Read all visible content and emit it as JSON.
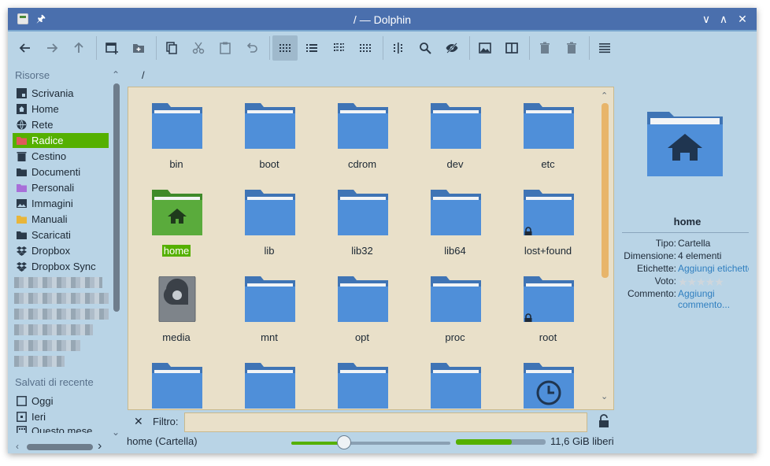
{
  "window": {
    "title": "/ — Dolphin",
    "controls": [
      "minimize",
      "maximize",
      "close"
    ]
  },
  "toolbar": {
    "buttons": [
      {
        "name": "back",
        "icon": "arrow-left-icon"
      },
      {
        "name": "forward",
        "icon": "arrow-right-icon"
      },
      {
        "name": "up",
        "icon": "arrow-up-icon"
      },
      {
        "name": "new-window",
        "icon": "new-window-icon"
      },
      {
        "name": "new-folder",
        "icon": "new-folder-icon"
      },
      {
        "name": "copy",
        "icon": "copy-icon"
      },
      {
        "name": "cut",
        "icon": "scissors-icon"
      },
      {
        "name": "paste",
        "icon": "paste-icon"
      },
      {
        "name": "undo",
        "icon": "undo-icon"
      },
      {
        "name": "icons-view",
        "icon": "icons-view-icon",
        "active": true
      },
      {
        "name": "details-view",
        "icon": "details-view-icon"
      },
      {
        "name": "compact-view",
        "icon": "compact-view-icon"
      },
      {
        "name": "preview-view",
        "icon": "grid-small-icon"
      },
      {
        "name": "columns",
        "icon": "columns-dots-icon"
      },
      {
        "name": "search",
        "icon": "search-icon"
      },
      {
        "name": "hidden-files",
        "icon": "eye-hidden-icon"
      },
      {
        "name": "previews",
        "icon": "image-icon"
      },
      {
        "name": "split",
        "icon": "split-view-icon"
      },
      {
        "name": "trash",
        "icon": "trash-icon"
      },
      {
        "name": "delete",
        "icon": "delete-icon"
      },
      {
        "name": "menu",
        "icon": "hamburger-menu-icon"
      }
    ]
  },
  "sidebar": {
    "places_header": "Risorse",
    "places": [
      {
        "label": "Scrivania",
        "icon": "desktop-icon"
      },
      {
        "label": "Home",
        "icon": "home-icon"
      },
      {
        "label": "Rete",
        "icon": "network-icon"
      },
      {
        "label": "Radice",
        "icon": "root-folder-icon",
        "selected": true
      },
      {
        "label": "Cestino",
        "icon": "trash-icon"
      },
      {
        "label": "Documenti",
        "icon": "documents-folder-icon"
      },
      {
        "label": "Personali",
        "icon": "personal-folder-icon"
      },
      {
        "label": "Immagini",
        "icon": "pictures-folder-icon"
      },
      {
        "label": "Manuali",
        "icon": "manuals-folder-icon"
      },
      {
        "label": "Scaricati",
        "icon": "downloads-folder-icon"
      },
      {
        "label": "Dropbox",
        "icon": "dropbox-icon"
      },
      {
        "label": "Dropbox Sync",
        "icon": "dropbox-icon"
      }
    ],
    "recent_header": "Salvati di recente",
    "recent": [
      {
        "label": "Oggi",
        "icon": "calendar-today-icon"
      },
      {
        "label": "Ieri",
        "icon": "calendar-yesterday-icon"
      },
      {
        "label": "Questo mese",
        "icon": "calendar-month-icon"
      }
    ]
  },
  "breadcrumb": "/",
  "files": [
    {
      "label": "bin",
      "type": "folder"
    },
    {
      "label": "boot",
      "type": "folder"
    },
    {
      "label": "cdrom",
      "type": "folder"
    },
    {
      "label": "dev",
      "type": "folder"
    },
    {
      "label": "etc",
      "type": "folder"
    },
    {
      "label": "home",
      "type": "home",
      "selected": true
    },
    {
      "label": "lib",
      "type": "folder"
    },
    {
      "label": "lib32",
      "type": "folder"
    },
    {
      "label": "lib64",
      "type": "folder"
    },
    {
      "label": "lost+found",
      "type": "locked"
    },
    {
      "label": "media",
      "type": "media"
    },
    {
      "label": "mnt",
      "type": "folder"
    },
    {
      "label": "opt",
      "type": "folder"
    },
    {
      "label": "proc",
      "type": "folder"
    },
    {
      "label": "root",
      "type": "locked"
    },
    {
      "label": "",
      "type": "folder"
    },
    {
      "label": "",
      "type": "folder"
    },
    {
      "label": "",
      "type": "folder"
    },
    {
      "label": "",
      "type": "folder"
    },
    {
      "label": "",
      "type": "clock"
    }
  ],
  "info": {
    "name": "home",
    "rows": [
      {
        "key": "Tipo:",
        "value": "Cartella",
        "link": false
      },
      {
        "key": "Dimensione:",
        "value": "4 elementi",
        "link": false
      },
      {
        "key": "Etichette:",
        "value": "Aggiungi etichette",
        "link": true
      },
      {
        "key": "Voto:",
        "value": "★★★★★",
        "link": false,
        "stars": 0
      },
      {
        "key": "Commento:",
        "value": "Aggiungi commento...",
        "link": true
      }
    ]
  },
  "filter": {
    "label": "Filtro:",
    "value": ""
  },
  "status": {
    "text": "home (Cartella)",
    "zoom_fraction": 0.33,
    "free_space": "11,6 GiB liberi",
    "used_fraction": 0.62
  },
  "colors": {
    "titlebar": "#4a6fad",
    "window_bg": "#b9d4e6",
    "selection": "#55b000",
    "folder": "#4f8fd9",
    "folder_tab": "#3f74b5",
    "view_bg": "#e9e0c9"
  }
}
